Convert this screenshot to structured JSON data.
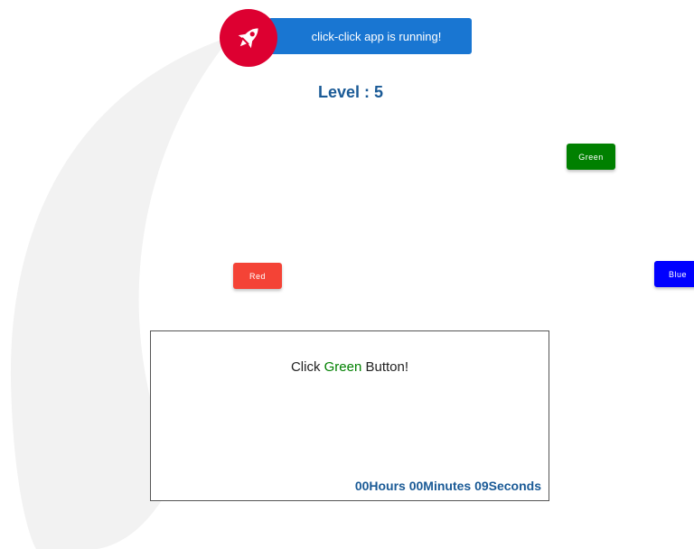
{
  "banner": {
    "text": "click-click app is running!",
    "accent": "#1976d2",
    "badge_color": "#dd0031",
    "icon": "rocket-icon"
  },
  "level": {
    "text": "Level : 5"
  },
  "buttons": {
    "green": {
      "label": "Green",
      "color": "#008000"
    },
    "red": {
      "label": "Red",
      "color": "#f44336"
    },
    "blue": {
      "label": "Blue",
      "color": "#0000ff"
    }
  },
  "panel": {
    "instruction_prefix": "Click ",
    "instruction_target": "Green",
    "instruction_suffix": " Button!",
    "target_color": "#008000",
    "timer": "00Hours 00Minutes 09Seconds"
  }
}
